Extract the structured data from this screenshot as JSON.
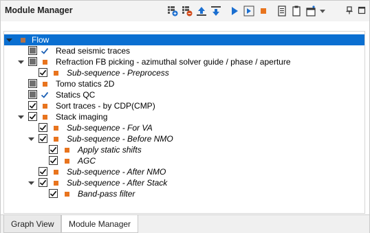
{
  "window": {
    "title": "Module Manager"
  },
  "toolbar": {
    "buttons": [
      "add-flow-icon",
      "remove-flow-icon",
      "move-up-icon",
      "move-down-icon",
      "run-icon",
      "run-step-icon",
      "stop-icon",
      "log-icon",
      "clipboard-icon",
      "new-window-icon",
      "dropdown-icon"
    ]
  },
  "tree": {
    "root": {
      "label": "Flow",
      "selected": true
    },
    "items": [
      {
        "label": "Read seismic traces",
        "state": "partial",
        "status": "check",
        "italic": false
      },
      {
        "label": "Refraction FB picking - azimuthal solver guide / phase / aperture",
        "state": "partial",
        "status": "square",
        "italic": false
      },
      {
        "label": "Sub-sequence - Preprocess",
        "state": "checked",
        "status": "square",
        "italic": true
      },
      {
        "label": "Tomo statics 2D",
        "state": "partial",
        "status": "square",
        "italic": false
      },
      {
        "label": "Statics QC",
        "state": "partial",
        "status": "check",
        "italic": false
      },
      {
        "label": "Sort traces - by CDP(CMP)",
        "state": "checked",
        "status": "square",
        "italic": false
      },
      {
        "label": "Stack imaging",
        "state": "checked",
        "status": "square",
        "italic": false
      },
      {
        "label": "Sub-sequence - For VA",
        "state": "checked",
        "status": "square",
        "italic": true
      },
      {
        "label": "Sub-sequence - Before NMO",
        "state": "checked",
        "status": "square",
        "italic": true
      },
      {
        "label": "Apply static shifts",
        "state": "checked",
        "status": "square",
        "italic": true
      },
      {
        "label": "AGC",
        "state": "checked",
        "status": "square",
        "italic": true
      },
      {
        "label": "Sub-sequence - After NMO",
        "state": "checked",
        "status": "square",
        "italic": true
      },
      {
        "label": "Sub-sequence - After Stack",
        "state": "checked",
        "status": "square",
        "italic": true
      },
      {
        "label": "Band-pass filter",
        "state": "checked",
        "status": "square",
        "italic": true
      }
    ]
  },
  "tabs": [
    {
      "label": "Graph View",
      "active": false
    },
    {
      "label": "Module Manager",
      "active": true
    }
  ],
  "colors": {
    "selection": "#0a6fd1",
    "accent_orange": "#e8741e",
    "check_blue": "#1a5fb4"
  }
}
